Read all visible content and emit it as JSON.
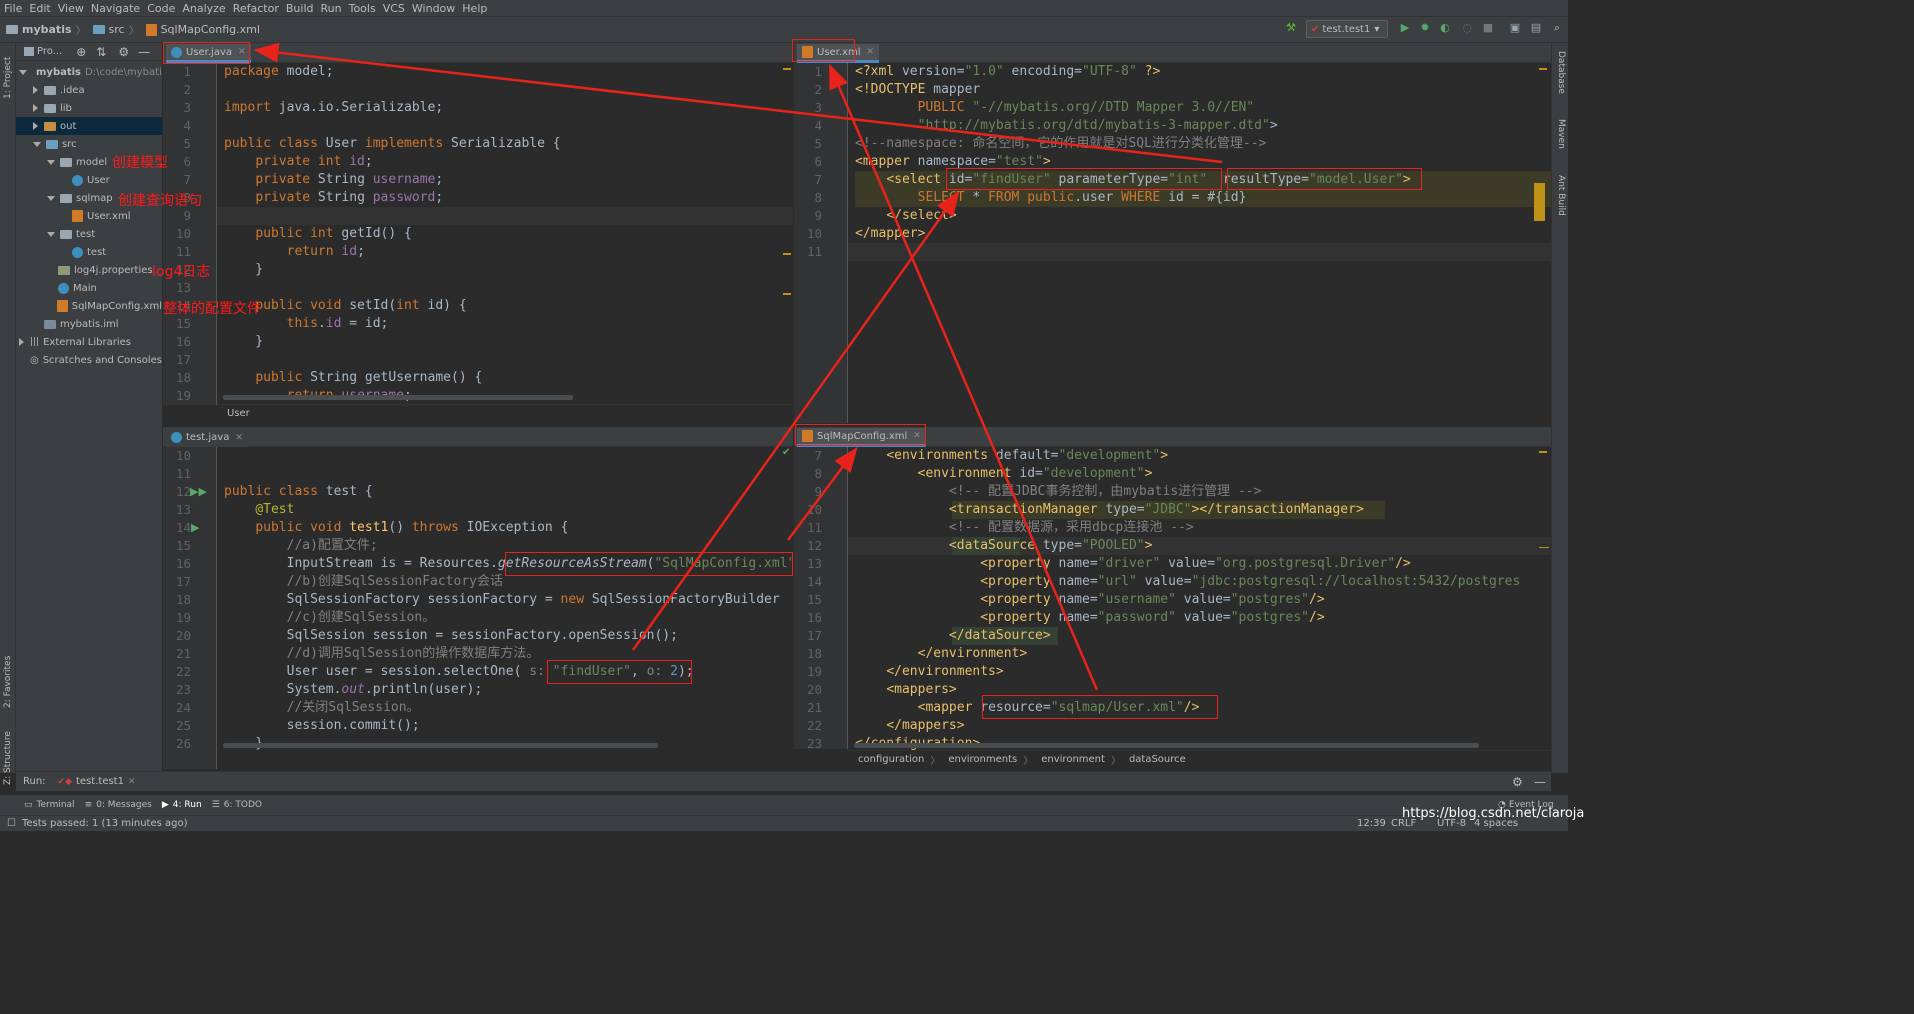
{
  "menu": [
    "File",
    "Edit",
    "View",
    "Navigate",
    "Code",
    "Analyze",
    "Refactor",
    "Build",
    "Run",
    "Tools",
    "VCS",
    "Window",
    "Help"
  ],
  "nav": {
    "project": "mybatis",
    "folder": "src",
    "file": "SqlMapConfig.xml",
    "run_config": "test.test1"
  },
  "left_strip": {
    "project": "1: Project",
    "favorites": "2: Favorites",
    "structure": "Z: Structure"
  },
  "right_strip": {
    "database": "Database",
    "maven": "Maven",
    "ant": "Ant Build"
  },
  "project_panel": {
    "header": "Pro...",
    "tree": [
      {
        "label": "mybatis",
        "extra": "D:\\code\\mybatis",
        "indent": 0,
        "arrow": "down",
        "icon": "folder"
      },
      {
        "label": ".idea",
        "indent": 1,
        "arrow": "right",
        "icon": "folder"
      },
      {
        "label": "lib",
        "indent": 1,
        "arrow": "right",
        "icon": "folder"
      },
      {
        "label": "out",
        "indent": 1,
        "arrow": "right",
        "icon": "folder-orange",
        "selected": true
      },
      {
        "label": "src",
        "indent": 1,
        "arrow": "down",
        "icon": "folder-blue"
      },
      {
        "label": "model",
        "indent": 2,
        "arrow": "down",
        "icon": "folder"
      },
      {
        "label": "User",
        "indent": 3,
        "arrow": "",
        "icon": "java"
      },
      {
        "label": "sqlmap",
        "indent": 2,
        "arrow": "down",
        "icon": "folder"
      },
      {
        "label": "User.xml",
        "indent": 3,
        "arrow": "",
        "icon": "xml"
      },
      {
        "label": "test",
        "indent": 2,
        "arrow": "down",
        "icon": "folder"
      },
      {
        "label": "test",
        "indent": 3,
        "arrow": "",
        "icon": "java"
      },
      {
        "label": "log4j.properties",
        "indent": 2,
        "arrow": "",
        "icon": "props"
      },
      {
        "label": "Main",
        "indent": 2,
        "arrow": "",
        "icon": "java"
      },
      {
        "label": "SqlMapConfig.xml",
        "indent": 2,
        "arrow": "",
        "icon": "xml"
      },
      {
        "label": "mybatis.iml",
        "indent": 1,
        "arrow": "",
        "icon": "iml"
      },
      {
        "label": "External Libraries",
        "indent": 0,
        "arrow": "right",
        "icon": "lib"
      },
      {
        "label": "Scratches and Consoles",
        "indent": 0,
        "arrow": "",
        "icon": "scratch"
      }
    ]
  },
  "annotations": {
    "model": "创建模型",
    "sqlmap": "创建查询语句",
    "log4j": "log4日志",
    "config": "整体的配置文件"
  },
  "editors": {
    "user_java": {
      "tab": "User.java",
      "breadcrumb": "User",
      "lines": [
        {
          "n": "1",
          "html": "<span class='kw'>package</span> model;"
        },
        {
          "n": "2",
          "html": ""
        },
        {
          "n": "3",
          "html": "<span class='kw'>import</span> java.io.Serializable;"
        },
        {
          "n": "4",
          "html": ""
        },
        {
          "n": "5",
          "html": "<span class='kw'>public class</span> User <span class='kw'>implements</span> Serializable {"
        },
        {
          "n": "6",
          "html": "    <span class='kw'>private int</span> <span class='fld'>id</span>;"
        },
        {
          "n": "7",
          "html": "    <span class='kw'>private</span> String <span class='fld'>username</span>;"
        },
        {
          "n": "8",
          "html": "    <span class='kw'>private</span> String <span class='fld'>password</span>;"
        },
        {
          "n": "9",
          "html": ""
        },
        {
          "n": "10",
          "html": "    <span class='kw'>public int</span> getId() {"
        },
        {
          "n": "11",
          "html": "        <span class='kw'>return</span> <span class='fld'>id</span>;"
        },
        {
          "n": "12",
          "html": "    }"
        },
        {
          "n": "13",
          "html": ""
        },
        {
          "n": "14",
          "html": "    <span class='kw'>public void</span> setId(<span class='kw'>int</span> id) {"
        },
        {
          "n": "15",
          "html": "        <span class='kw'>this</span>.<span class='fld'>id</span> = id;"
        },
        {
          "n": "16",
          "html": "    }"
        },
        {
          "n": "17",
          "html": ""
        },
        {
          "n": "18",
          "html": "    <span class='kw'>public</span> String getUsername() {"
        },
        {
          "n": "19",
          "html": "        <span class='kw'>return</span> <span class='fld'>username</span>;"
        }
      ]
    },
    "user_xml": {
      "tab": "User.xml",
      "lines": [
        {
          "n": "1",
          "html": "<span class='tag'>&lt;?xml</span> version=<span class='str'>\"1.0\"</span> encoding=<span class='str'>\"UTF-8\"</span> <span class='tag'>?&gt;</span>"
        },
        {
          "n": "2",
          "html": "<span class='tag'>&lt;!DOCTYPE</span> mapper"
        },
        {
          "n": "3",
          "html": "        <span class='kw'>PUBLIC</span> <span class='str'>\"-//mybatis.org//DTD Mapper 3.0//EN\"</span>"
        },
        {
          "n": "4",
          "html": "        <span class='str'>\"http://mybatis.org/dtd/mybatis-3-mapper.dtd\"</span>&gt;"
        },
        {
          "n": "5",
          "html": "<span class='cmt'>&lt;!--namespace: 命名空间，它的作用就是对SQL进行分类化管理--&gt;</span>"
        },
        {
          "n": "6",
          "html": "<span class='tag'>&lt;mapper</span> namespace=<span class='str'>\"test\"</span><span class='tag'>&gt;</span>"
        },
        {
          "n": "7",
          "html": "    <span class='tag'>&lt;select</span> id=<span class='str'>\"findUser\"</span> parameterType=<span class='str'>\"int\"</span>  resultType=<span class='str'>\"model.User\"</span><span class='tag'>&gt;</span>"
        },
        {
          "n": "8",
          "html": "        <span class='kw'>SELECT</span> * <span class='kw'>FROM</span> <span class='kw'>public</span>.user <span class='kw'>WHERE</span> id = #{id}"
        },
        {
          "n": "9",
          "html": "    <span class='tag'>&lt;/select&gt;</span>"
        },
        {
          "n": "10",
          "html": "<span class='tag'>&lt;/mapper&gt;</span>"
        },
        {
          "n": "11",
          "html": ""
        }
      ]
    },
    "test_java": {
      "tab": "test.java",
      "lines": [
        {
          "n": "10",
          "html": ""
        },
        {
          "n": "11",
          "html": ""
        },
        {
          "n": "12",
          "html": "<span class='kw'>public class</span> test {"
        },
        {
          "n": "13",
          "html": "    <span class='ann'>@Test</span>"
        },
        {
          "n": "14",
          "html": "    <span class='kw'>public void</span> <span class='meth'>test1</span>() <span class='kw'>throws</span> IOException {"
        },
        {
          "n": "15",
          "html": "        <span class='cmt'>//a)配置文件;</span>"
        },
        {
          "n": "16",
          "html": "        InputStream is = Resources.<span class='it'>getResourceAsStream</span>(<span class='str'>\"SqlMapConfig.xml\"</span>);"
        },
        {
          "n": "17",
          "html": "        <span class='cmt'>//b)创建SqlSessionFactory会话</span>"
        },
        {
          "n": "18",
          "html": "        SqlSessionFactory sessionFactory = <span class='kw'>new</span> SqlSessionFactoryBuilder"
        },
        {
          "n": "19",
          "html": "        <span class='cmt'>//c)创建SqlSession。</span>"
        },
        {
          "n": "20",
          "html": "        SqlSession session = sessionFactory.openSession();"
        },
        {
          "n": "21",
          "html": "        <span class='cmt'>//d)调用SqlSession的操作数据库方法。</span>"
        },
        {
          "n": "22",
          "html": "        User user = session.selectOne( <span class='cmt'>s:</span> <span class='str'>\"findUser\"</span>, <span class='cmt'>o:</span> <span class='num'>2</span>);"
        },
        {
          "n": "23",
          "html": "        System.<span class='fld it'>out</span>.println(user);"
        },
        {
          "n": "24",
          "html": "        <span class='cmt'>//关闭SqlSession。</span>"
        },
        {
          "n": "25",
          "html": "        session.commit();"
        },
        {
          "n": "26",
          "html": "    }"
        }
      ]
    },
    "config_xml": {
      "tab": "SqlMapConfig.xml",
      "breadcrumb": [
        "configuration",
        "environments",
        "environment",
        "dataSource"
      ],
      "lines": [
        {
          "n": "7",
          "html": "    <span class='tag'>&lt;environments</span> default=<span class='str'>\"development\"</span><span class='tag'>&gt;</span>"
        },
        {
          "n": "8",
          "html": "        <span class='tag'>&lt;environment</span> id=<span class='str'>\"development\"</span><span class='tag'>&gt;</span>"
        },
        {
          "n": "9",
          "html": "            <span class='cmt'>&lt;!-- 配置JDBC事务控制，由mybatis进行管理 --&gt;</span>"
        },
        {
          "n": "10",
          "html": "            <span class='tag'>&lt;transactionManager</span> type=<span class='str'>\"JDBC\"</span><span class='tag'>&gt;&lt;/transactionManager&gt;</span>"
        },
        {
          "n": "11",
          "html": "            <span class='cmt'>&lt;!-- 配置数据源，采用dbcp连接池 --&gt;</span>"
        },
        {
          "n": "12",
          "html": "            <span class='tag'>&lt;dataSource</span> type=<span class='str'>\"POOLED\"</span><span class='tag'>&gt;</span>"
        },
        {
          "n": "13",
          "html": "                <span class='tag'>&lt;property</span> name=<span class='str'>\"driver\"</span> value=<span class='str'>\"org.postgresql.Driver\"</span><span class='tag'>/&gt;</span>"
        },
        {
          "n": "14",
          "html": "                <span class='tag'>&lt;property</span> name=<span class='str'>\"url\"</span> value=<span class='str'>\"jdbc:postgresql://localhost:5432/postgres</span>"
        },
        {
          "n": "15",
          "html": "                <span class='tag'>&lt;property</span> name=<span class='str'>\"username\"</span> value=<span class='str'>\"postgres\"</span><span class='tag'>/&gt;</span>"
        },
        {
          "n": "16",
          "html": "                <span class='tag'>&lt;property</span> name=<span class='str'>\"password\"</span> value=<span class='str'>\"postgres\"</span><span class='tag'>/&gt;</span>"
        },
        {
          "n": "17",
          "html": "            <span class='tag'>&lt;/dataSource&gt;</span>"
        },
        {
          "n": "18",
          "html": "        <span class='tag'>&lt;/environment&gt;</span>"
        },
        {
          "n": "19",
          "html": "    <span class='tag'>&lt;/environments&gt;</span>"
        },
        {
          "n": "20",
          "html": "    <span class='tag'>&lt;mappers&gt;</span>"
        },
        {
          "n": "21",
          "html": "        <span class='tag'>&lt;mapper</span> resource=<span class='str'>\"sqlmap/User.xml\"</span><span class='tag'>/&gt;</span>"
        },
        {
          "n": "22",
          "html": "    <span class='tag'>&lt;/mappers&gt;</span>"
        },
        {
          "n": "23",
          "html": "<span class='tag'>&lt;/configuration&gt;</span>"
        }
      ]
    }
  },
  "run_bar": {
    "label": "Run:",
    "config": "test.test1"
  },
  "bottom_tabs": [
    {
      "key": "Terminal",
      "label": "Terminal"
    },
    {
      "key": "0",
      "label": "0: Messages"
    },
    {
      "key": "4",
      "label": "4: Run"
    },
    {
      "key": "6",
      "label": "6: TODO"
    }
  ],
  "event_log": "Event Log",
  "status": {
    "message": "Tests passed: 1 (13 minutes ago)",
    "pos": "12:39",
    "line_sep": "CRLF",
    "encoding": "UTF-8",
    "indent": "4 spaces",
    "watermark": "https://blog.csdn.net/claroja"
  },
  "colors": {
    "accent": "#4a88c7",
    "annotation": "#ff1a1a",
    "background": "#2b2b2b",
    "panel": "#3c3f41"
  }
}
